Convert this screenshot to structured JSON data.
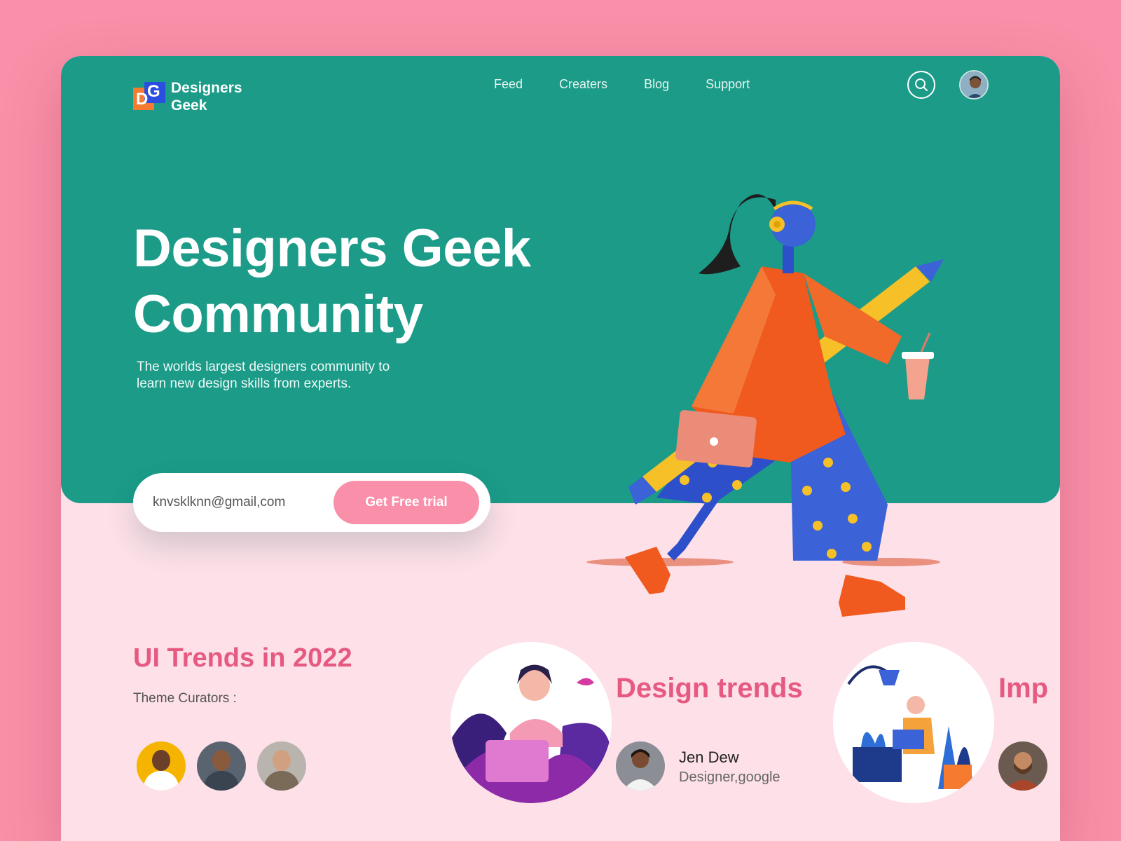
{
  "brand": {
    "name_line1": "Designers",
    "name_line2": "Geek",
    "mark_letters": [
      "D",
      "G"
    ]
  },
  "nav": {
    "items": [
      "Feed",
      "Creaters",
      "Blog",
      "Support"
    ]
  },
  "icons": {
    "search": "search-icon",
    "avatar": "user-avatar"
  },
  "hero": {
    "title_line1": "Designers Geek",
    "title_line2": "Community",
    "subtitle_line1": "The worlds largest designers community to",
    "subtitle_line2": "learn new design skills from experts."
  },
  "signup": {
    "email_value": "knvsklknn@gmail,com",
    "button_label": "Get Free trial"
  },
  "trends": {
    "title": "UI Trends in 2022",
    "curators_label": "Theme Curators :",
    "cards": [
      {
        "title": "Design trends",
        "author_name": "Jen Dew",
        "author_role": "Designer,google"
      },
      {
        "title": "Imp"
      }
    ]
  },
  "colors": {
    "background": "#f98fa8",
    "hero": "#1b9b88",
    "accent_pink": "#e65a82",
    "button": "#f98fa8",
    "logo_orange": "#f47b30",
    "logo_blue": "#2a4fe0"
  }
}
